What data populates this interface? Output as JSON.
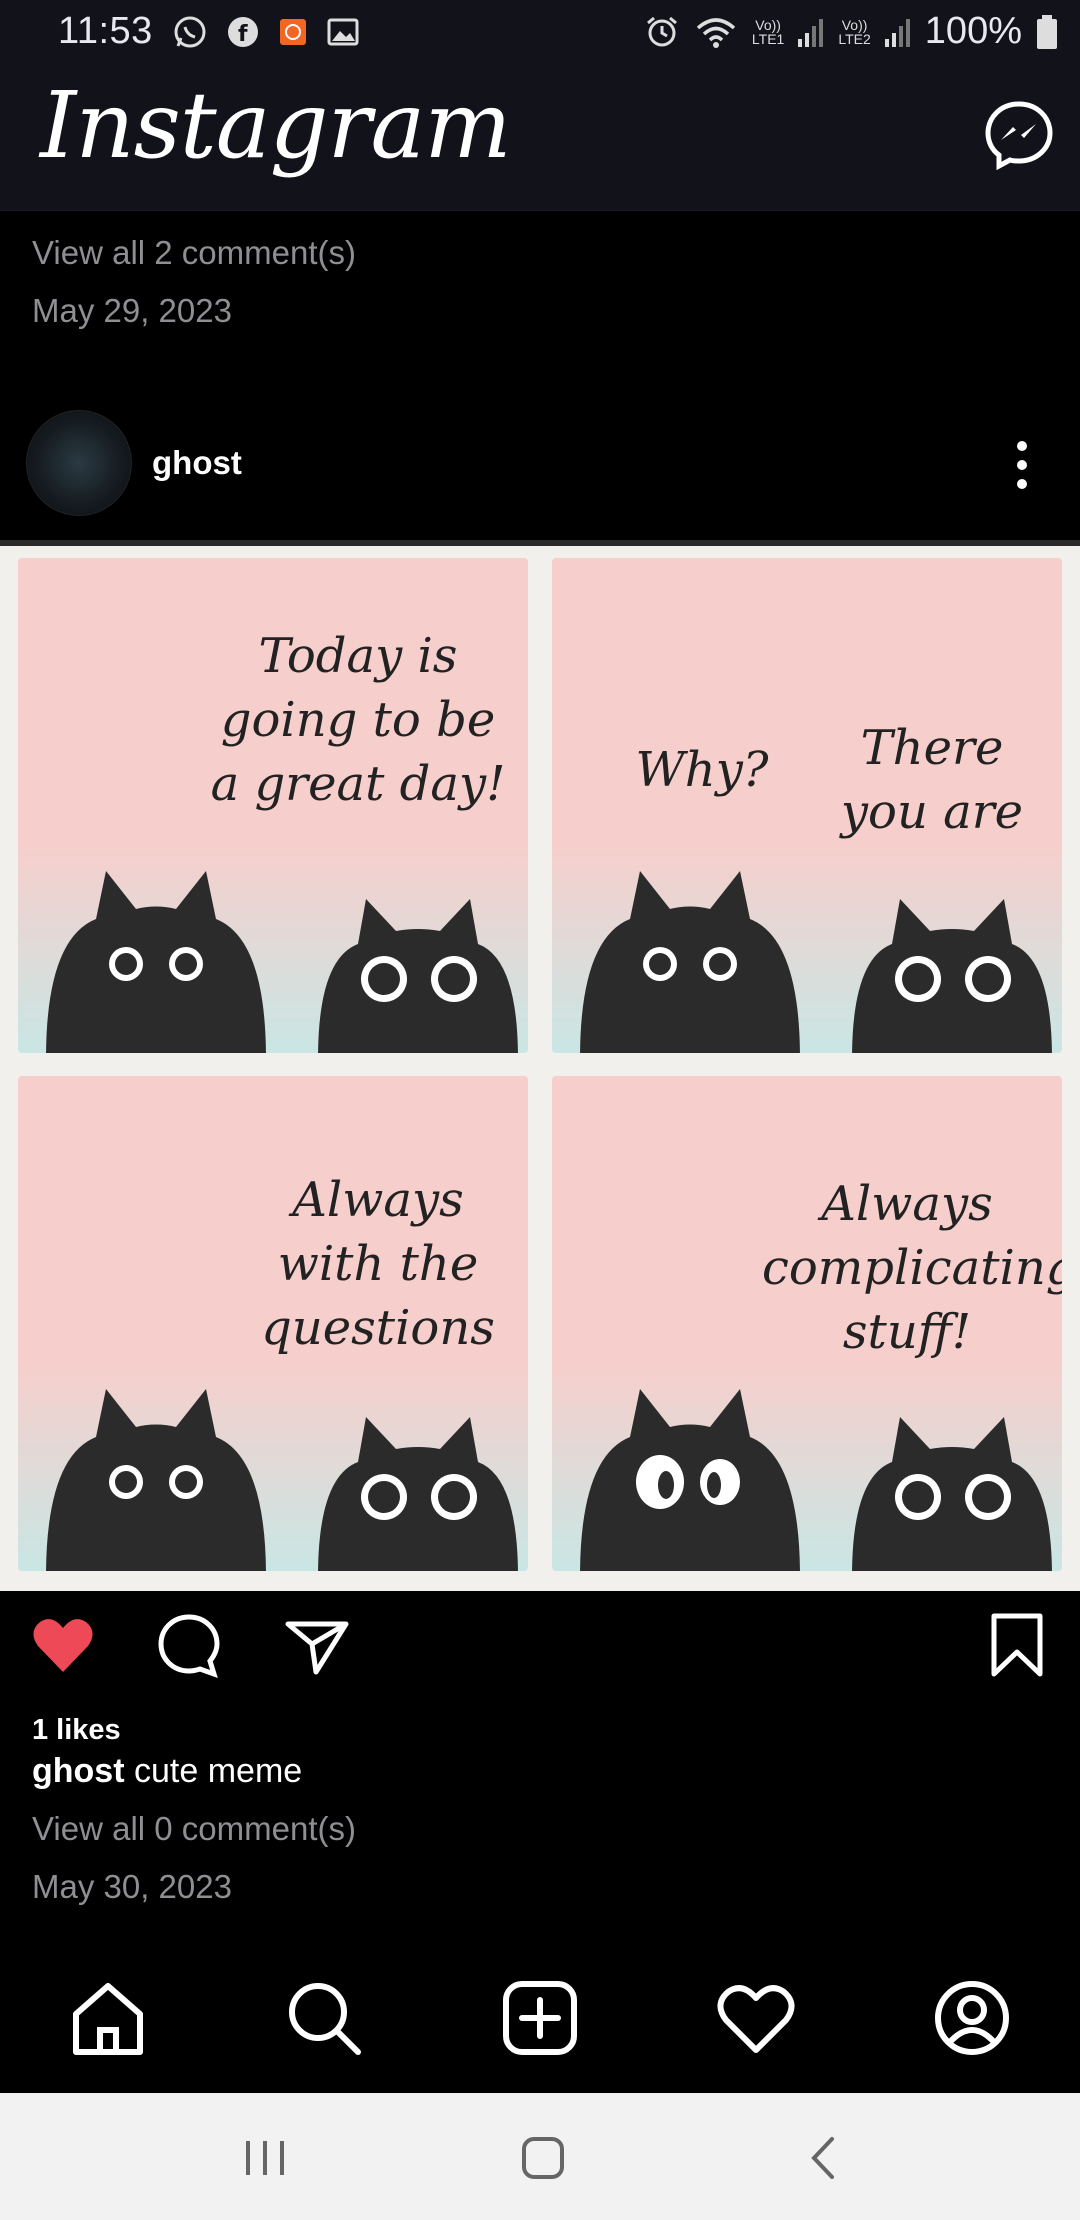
{
  "status_bar": {
    "time": "11:53",
    "battery": "100%",
    "sim1_label": "Vo))\nLTE1",
    "sim2_label": "Vo))\nLTE2",
    "icons": [
      "whatsapp-icon",
      "facebook-icon",
      "app-notification-icon",
      "gallery-icon",
      "alarm-icon",
      "wifi-icon",
      "signal-icon",
      "battery-icon"
    ]
  },
  "app_bar": {
    "logo": "Instagram",
    "messenger_icon": "messenger-icon"
  },
  "previous_post": {
    "view_comments": "View all 2 comment(s)",
    "date": "May 29, 2023"
  },
  "post": {
    "username": "ghost",
    "panels": [
      {
        "text": "Today is\ngoing to be\na great day!"
      },
      {
        "text_left": "Why?",
        "text_right": "There\nyou are"
      },
      {
        "text": "Always\nwith the\nquestions"
      },
      {
        "text": "Always\ncomplicating\nstuff!"
      }
    ],
    "liked": true,
    "likes": "1 likes",
    "caption_user": "ghost",
    "caption_text": "cute meme",
    "view_comments": "View all 0 comment(s)",
    "date": "May 30, 2023",
    "colors": {
      "like": "#ed4956",
      "panel_pink": "#f6cfcc",
      "panel_blue": "#c9e6e4"
    }
  },
  "tab_bar": {
    "items": [
      "home-icon",
      "search-icon",
      "add-post-icon",
      "activity-heart-icon",
      "profile-icon"
    ]
  },
  "nav_bar": {
    "items": [
      "recent-apps-icon",
      "home-button-icon",
      "back-icon"
    ]
  }
}
